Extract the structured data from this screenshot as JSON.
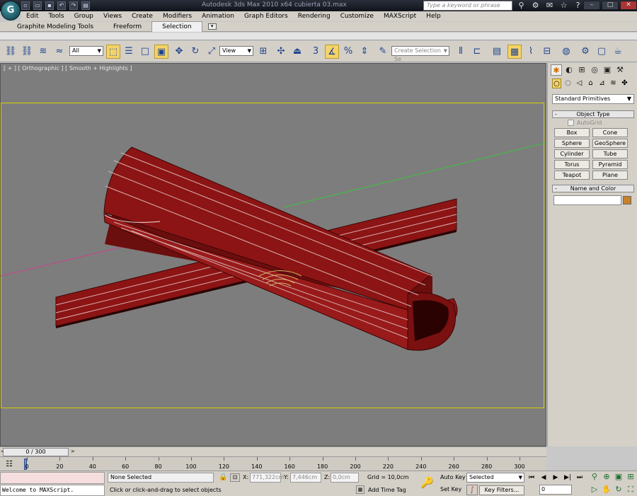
{
  "window": {
    "title": "Autodesk 3ds Max  2010 x64      cubierta 03.max",
    "search_placeholder": "Type a keyword or phrase",
    "app_button_icon": "3ds-max-app-icon",
    "minimize": "–",
    "maximize": "□",
    "close": "✕"
  },
  "menu": [
    "Edit",
    "Tools",
    "Group",
    "Views",
    "Create",
    "Modifiers",
    "Animation",
    "Graph Editors",
    "Rendering",
    "Customize",
    "MAXScript",
    "Help"
  ],
  "ribbon": {
    "tabs": [
      "Graphite Modeling Tools",
      "Freeform",
      "Selection"
    ],
    "active_tab": "Selection",
    "toggle": "▾"
  },
  "toolbar": {
    "selection_filter": "All",
    "reference_coord": "View",
    "named_selection_placeholder": "Create Selection Se",
    "snap_value": "3"
  },
  "viewport": {
    "label": "[ + ] [ Orthographic ] [ Smooth + Highlights ]",
    "geometry_color": "#8b1010",
    "safe_frame_color": "#d8d100"
  },
  "command_panel": {
    "primitive_type": "Standard Primitives",
    "object_type_header": "Object Type",
    "autogrid_label": "AutoGrid",
    "buttons": [
      "Box",
      "Cone",
      "Sphere",
      "GeoSphere",
      "Cylinder",
      "Tube",
      "Torus",
      "Pyramid",
      "Teapot",
      "Plane"
    ],
    "name_color_header": "Name and Color",
    "object_color": "#c8802c"
  },
  "timeline": {
    "frame_display": "0 / 300",
    "left_arrow": "<",
    "right_arrow": ">",
    "ruler": [
      "0",
      "20",
      "40",
      "60",
      "80",
      "100",
      "120",
      "140",
      "160",
      "180",
      "200",
      "220",
      "240",
      "260",
      "280",
      "300"
    ]
  },
  "status": {
    "maxscript_output": "Welcome to MAXScript.",
    "selection": "None Selected",
    "prompt": "Click or click-and-drag to select objects",
    "x_label": "X:",
    "x_value": "771,322cm",
    "y_label": "Y:",
    "y_value": "7,446cm",
    "z_label": "Z:",
    "z_value": "0,0cm",
    "grid": "Grid = 10,0cm",
    "auto_key": "Auto Key",
    "set_key": "Set Key",
    "key_mode_dropdown": "Selected",
    "key_filters": "Key Filters...",
    "add_time_tag": "Add Time Tag",
    "current_frame": "0"
  }
}
